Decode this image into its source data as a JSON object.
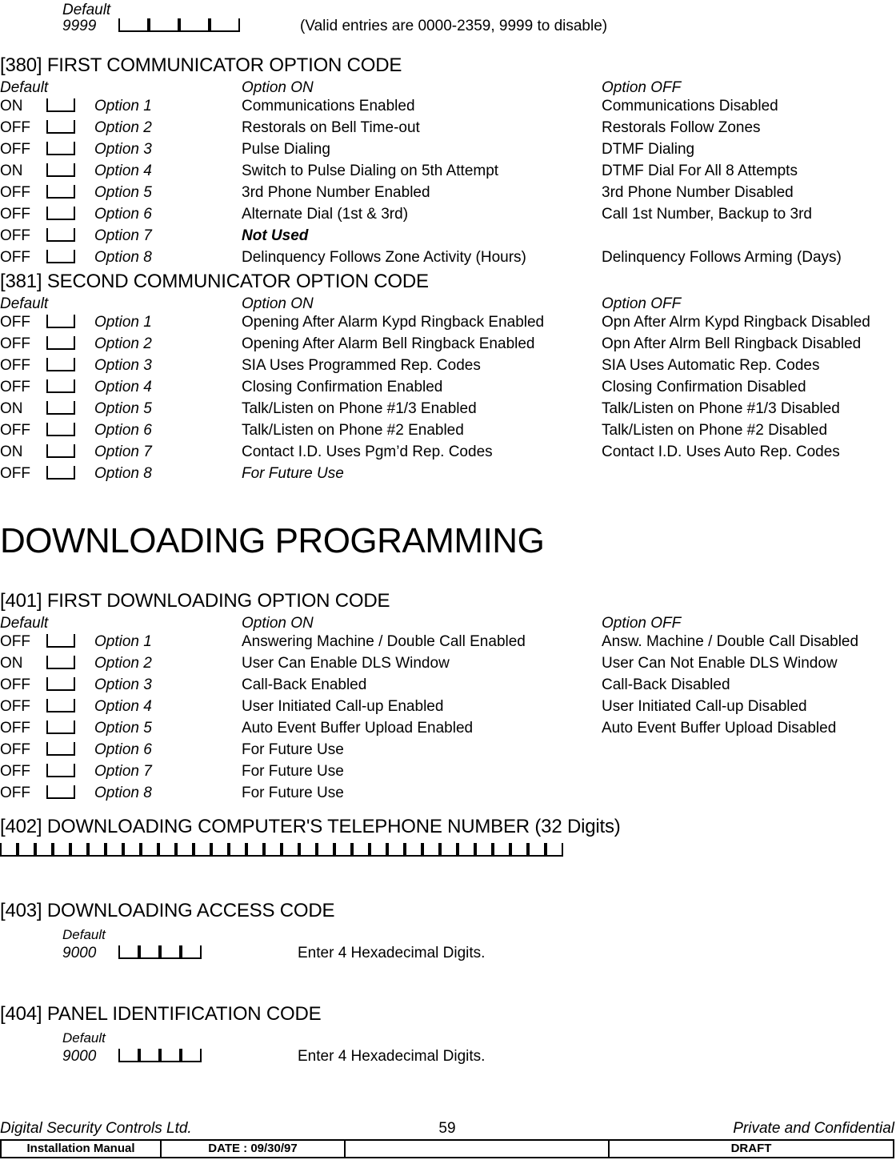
{
  "top_entry": {
    "default_label": "Default",
    "default_value": "9999",
    "note": "(Valid entries are 0000-2359, 9999 to disable)"
  },
  "headers": {
    "default": "Default",
    "option_on": "Option ON",
    "option_off": "Option OFF"
  },
  "section_380": {
    "title": "[380] FIRST COMMUNICATOR OPTION CODE",
    "rows": [
      {
        "default": "ON",
        "option": "Option 1",
        "on": "Communications Enabled",
        "off": "Communications Disabled"
      },
      {
        "default": "OFF",
        "option": "Option 2",
        "on": "Restorals on Bell Time-out",
        "off": "Restorals Follow Zones"
      },
      {
        "default": "OFF",
        "option": "Option 3",
        "on": "Pulse Dialing",
        "off": "DTMF Dialing"
      },
      {
        "default": "ON",
        "option": "Option 4",
        "on": "Switch to Pulse Dialing on 5th Attempt",
        "off": "DTMF Dial For All 8 Attempts"
      },
      {
        "default": "OFF",
        "option": "Option 5",
        "on": "3rd Phone Number Enabled",
        "off": "3rd Phone Number Disabled"
      },
      {
        "default": "OFF",
        "option": "Option 6",
        "on": "Alternate Dial (1st & 3rd)",
        "off": "Call 1st Number, Backup to 3rd"
      },
      {
        "default": "OFF",
        "option": "Option 7",
        "on": "Not Used",
        "off": ""
      },
      {
        "default": "OFF",
        "option": "Option 8",
        "on": "Delinquency Follows Zone Activity (Hours)",
        "off": "Delinquency Follows Arming (Days)"
      }
    ]
  },
  "section_381": {
    "title": "[381] SECOND COMMUNICATOR OPTION CODE",
    "rows": [
      {
        "default": "OFF",
        "option": "Option 1",
        "on": "Opening After Alarm Kypd Ringback Enabled",
        "off": "Opn After Alrm Kypd Ringback Disabled"
      },
      {
        "default": "OFF",
        "option": "Option 2",
        "on": "Opening After Alarm Bell Ringback Enabled",
        "off": "Opn After Alrm Bell Ringback Disabled"
      },
      {
        "default": "OFF",
        "option": "Option 3",
        "on": "SIA Uses Programmed Rep. Codes",
        "off": "SIA Uses Automatic Rep. Codes"
      },
      {
        "default": "OFF",
        "option": "Option 4",
        "on": "Closing Confirmation Enabled",
        "off": "Closing Confirmation Disabled"
      },
      {
        "default": "ON",
        "option": "Option 5",
        "on": "Talk/Listen on Phone #1/3 Enabled",
        "off": "Talk/Listen on Phone #1/3 Disabled"
      },
      {
        "default": "OFF",
        "option": "Option 6",
        "on": "Talk/Listen on Phone #2 Enabled",
        "off": "Talk/Listen on Phone #2 Disabled"
      },
      {
        "default": "ON",
        "option": "Option 7",
        "on": "Contact I.D. Uses Pgm’d Rep. Codes",
        "off": "Contact I.D. Uses Auto Rep. Codes"
      },
      {
        "default": "OFF",
        "option": "Option 8",
        "on": "For Future Use",
        "off": ""
      }
    ]
  },
  "downloading_heading": "DOWNLOADING PROGRAMMING",
  "section_401": {
    "title": "[401] FIRST DOWNLOADING OPTION CODE",
    "rows": [
      {
        "default": "OFF",
        "option": "Option 1",
        "on": "Answering Machine / Double Call Enabled",
        "off": "Answ. Machine / Double Call Disabled"
      },
      {
        "default": "ON",
        "option": "Option 2",
        "on": "User Can Enable DLS Window",
        "off": "User Can Not Enable DLS Window"
      },
      {
        "default": "OFF",
        "option": "Option 3",
        "on": "Call-Back Enabled",
        "off": "Call-Back Disabled"
      },
      {
        "default": "OFF",
        "option": "Option 4",
        "on": "User Initiated Call-up Enabled",
        "off": "User Initiated Call-up Disabled"
      },
      {
        "default": "OFF",
        "option": "Option 5",
        "on": "Auto Event Buffer Upload Enabled",
        "off": "Auto Event Buffer Upload Disabled"
      },
      {
        "default": "OFF",
        "option": "Option 6",
        "on": "For Future Use",
        "off": ""
      },
      {
        "default": "OFF",
        "option": "Option 7",
        "on": "For Future Use",
        "off": ""
      },
      {
        "default": "OFF",
        "option": "Option 8",
        "on": "For Future Use",
        "off": ""
      }
    ]
  },
  "section_402": {
    "title": "[402] DOWNLOADING COMPUTER'S TELEPHONE NUMBER (32 Digits)",
    "digit_count": 32
  },
  "section_403": {
    "title": "[403] DOWNLOADING ACCESS CODE",
    "default_label": "Default",
    "default_value": "9000",
    "note": "Enter 4 Hexadecimal Digits."
  },
  "section_404": {
    "title": "[404] PANEL IDENTIFICATION CODE",
    "default_label": "Default",
    "default_value": "9000",
    "note": "Enter 4 Hexadecimal Digits."
  },
  "footer": {
    "company": "Digital Security Controls Ltd.",
    "page_number": "59",
    "confidentiality": "Private and Confidential",
    "manual": "Installation Manual",
    "date": "DATE :  09/30/97",
    "blank": "",
    "status": "DRAFT"
  }
}
